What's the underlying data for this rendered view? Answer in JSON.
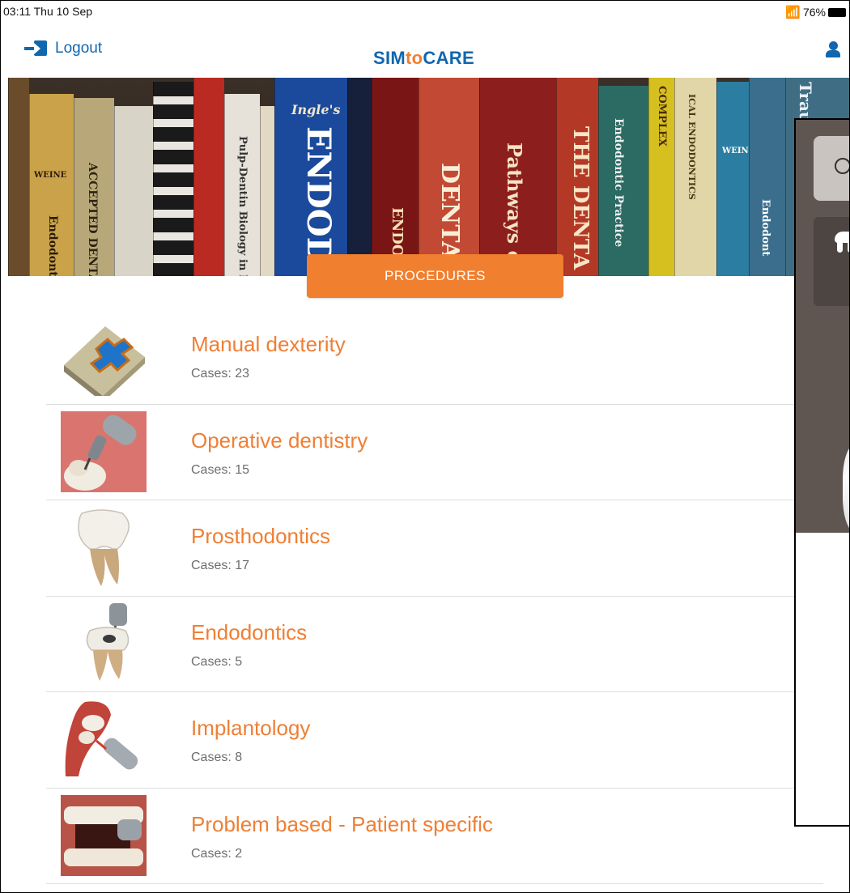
{
  "status_bar": {
    "time_date": "03:11  Thu 10 Sep",
    "battery": "76%"
  },
  "nav": {
    "logout_label": "Logout",
    "brand_a": "SIM",
    "brand_b": "to",
    "brand_c": "CARE"
  },
  "banner": {
    "button_label": "PROCEDURES",
    "book_titles": [
      "Endodont",
      "WEINE",
      "ACCEPTED DENTA",
      "Pulp-Dentin Biology in Resto",
      "Ingle's",
      "ENDODON",
      "ENDOD",
      "DENTA",
      "Pathways of",
      "THE DENTA",
      "Endodontic Practice",
      "COMPLEX",
      "ICAL ENDODONTICS",
      "WEINE",
      "Endodont",
      "Traumatic Injuries o"
    ]
  },
  "procedures": [
    {
      "title": "Manual dexterity",
      "cases": "Cases: 23",
      "thumb": "cross-block-image"
    },
    {
      "title": "Operative dentistry",
      "cases": "Cases: 15",
      "thumb": "drill-tooth-image"
    },
    {
      "title": "Prosthodontics",
      "cases": "Cases: 17",
      "thumb": "molar-image"
    },
    {
      "title": "Endodontics",
      "cases": "Cases: 5",
      "thumb": "endo-tooth-image"
    },
    {
      "title": "Implantology",
      "cases": "Cases: 8",
      "thumb": "implant-image"
    },
    {
      "title": "Problem based - Patient specific",
      "cases": "Cases: 2",
      "thumb": "open-mouth-image"
    }
  ],
  "colors": {
    "brand_blue": "#1167ae",
    "accent_orange": "#f07f2f",
    "title_orange": "#ee7f35"
  }
}
